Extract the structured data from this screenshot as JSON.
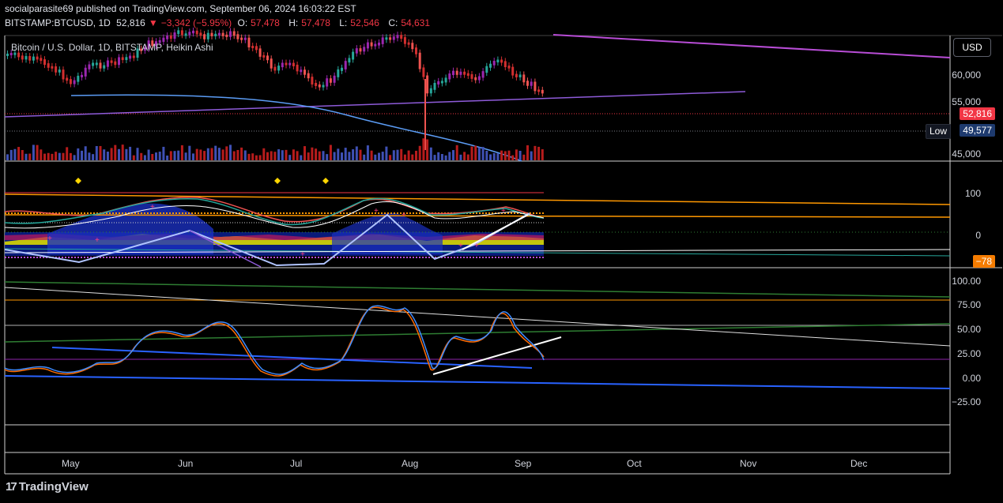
{
  "header": {
    "publish_line": "socialparasite69 published on TradingView.com, September 06, 2024 16:03:22 EST",
    "symbol": "BITSTAMP:BTCUSD, 1D",
    "last": "52,816",
    "change_arrow": "▼",
    "change": "−3,342 (−5.95%)",
    "o_label": "O:",
    "o_value": "57,478",
    "h_label": "H:",
    "h_value": "57,478",
    "l_label": "L:",
    "l_value": "52,546",
    "c_label": "C:",
    "c_value": "54,631"
  },
  "chart": {
    "title": "Bitcoin / U.S. Dollar, 1D, BITSTAMP, Heikin Ashi",
    "currency_button": "USD",
    "price_axis": [
      "60,000",
      "55,000",
      "45,000"
    ],
    "last_price_tag": "52,816",
    "low_label": "Low",
    "low_value": "49,577",
    "colors": {
      "bull": "#26a69a",
      "bear": "#ef5350",
      "last_tag": "#f23645",
      "low_tag": "#1e3a6e"
    }
  },
  "oscillator1": {
    "axis": [
      "100",
      "0"
    ],
    "value_tag": "−78",
    "tag_color": "#f57c00"
  },
  "oscillator2": {
    "axis": [
      "100.00",
      "75.00",
      "50.00",
      "25.00",
      "0.00",
      "−25.00"
    ]
  },
  "time_axis": [
    "May",
    "Jun",
    "Jul",
    "Aug",
    "Sep",
    "Oct",
    "Nov",
    "Dec"
  ],
  "footer": {
    "brand": "TradingView",
    "logo_icon": "tradingview-logo-icon"
  }
}
